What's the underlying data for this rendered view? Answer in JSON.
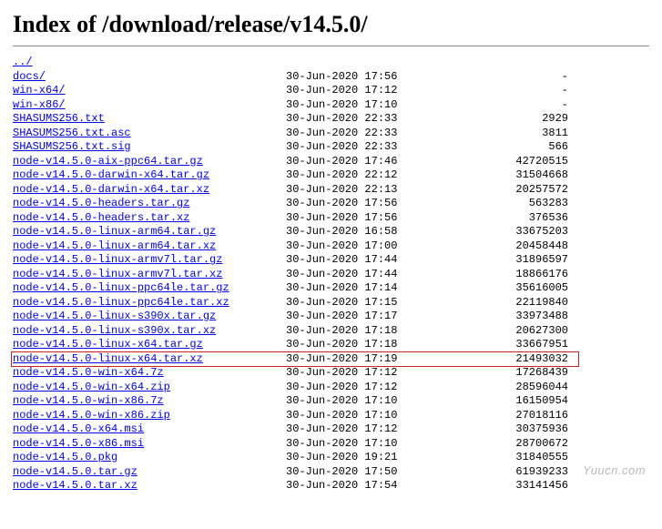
{
  "title": "Index of /download/release/v14.5.0/",
  "watermark": "Yuucn.com",
  "highlight_index": 21,
  "entries": [
    {
      "name": "../",
      "date": "",
      "size": ""
    },
    {
      "name": "docs/",
      "date": "30-Jun-2020 17:56",
      "size": "-"
    },
    {
      "name": "win-x64/",
      "date": "30-Jun-2020 17:12",
      "size": "-"
    },
    {
      "name": "win-x86/",
      "date": "30-Jun-2020 17:10",
      "size": "-"
    },
    {
      "name": "SHASUMS256.txt",
      "date": "30-Jun-2020 22:33",
      "size": "2929"
    },
    {
      "name": "SHASUMS256.txt.asc",
      "date": "30-Jun-2020 22:33",
      "size": "3811"
    },
    {
      "name": "SHASUMS256.txt.sig",
      "date": "30-Jun-2020 22:33",
      "size": "566"
    },
    {
      "name": "node-v14.5.0-aix-ppc64.tar.gz",
      "date": "30-Jun-2020 17:46",
      "size": "42720515"
    },
    {
      "name": "node-v14.5.0-darwin-x64.tar.gz",
      "date": "30-Jun-2020 22:12",
      "size": "31504668"
    },
    {
      "name": "node-v14.5.0-darwin-x64.tar.xz",
      "date": "30-Jun-2020 22:13",
      "size": "20257572"
    },
    {
      "name": "node-v14.5.0-headers.tar.gz",
      "date": "30-Jun-2020 17:56",
      "size": "563283"
    },
    {
      "name": "node-v14.5.0-headers.tar.xz",
      "date": "30-Jun-2020 17:56",
      "size": "376536"
    },
    {
      "name": "node-v14.5.0-linux-arm64.tar.gz",
      "date": "30-Jun-2020 16:58",
      "size": "33675203"
    },
    {
      "name": "node-v14.5.0-linux-arm64.tar.xz",
      "date": "30-Jun-2020 17:00",
      "size": "20458448"
    },
    {
      "name": "node-v14.5.0-linux-armv7l.tar.gz",
      "date": "30-Jun-2020 17:44",
      "size": "31896597"
    },
    {
      "name": "node-v14.5.0-linux-armv7l.tar.xz",
      "date": "30-Jun-2020 17:44",
      "size": "18866176"
    },
    {
      "name": "node-v14.5.0-linux-ppc64le.tar.gz",
      "date": "30-Jun-2020 17:14",
      "size": "35616005"
    },
    {
      "name": "node-v14.5.0-linux-ppc64le.tar.xz",
      "date": "30-Jun-2020 17:15",
      "size": "22119840"
    },
    {
      "name": "node-v14.5.0-linux-s390x.tar.gz",
      "date": "30-Jun-2020 17:17",
      "size": "33973488"
    },
    {
      "name": "node-v14.5.0-linux-s390x.tar.xz",
      "date": "30-Jun-2020 17:18",
      "size": "20627300"
    },
    {
      "name": "node-v14.5.0-linux-x64.tar.gz",
      "date": "30-Jun-2020 17:18",
      "size": "33667951"
    },
    {
      "name": "node-v14.5.0-linux-x64.tar.xz",
      "date": "30-Jun-2020 17:19",
      "size": "21493032"
    },
    {
      "name": "node-v14.5.0-win-x64.7z",
      "date": "30-Jun-2020 17:12",
      "size": "17268439"
    },
    {
      "name": "node-v14.5.0-win-x64.zip",
      "date": "30-Jun-2020 17:12",
      "size": "28596044"
    },
    {
      "name": "node-v14.5.0-win-x86.7z",
      "date": "30-Jun-2020 17:10",
      "size": "16150954"
    },
    {
      "name": "node-v14.5.0-win-x86.zip",
      "date": "30-Jun-2020 17:10",
      "size": "27018116"
    },
    {
      "name": "node-v14.5.0-x64.msi",
      "date": "30-Jun-2020 17:12",
      "size": "30375936"
    },
    {
      "name": "node-v14.5.0-x86.msi",
      "date": "30-Jun-2020 17:10",
      "size": "28700672"
    },
    {
      "name": "node-v14.5.0.pkg",
      "date": "30-Jun-2020 19:21",
      "size": "31840555"
    },
    {
      "name": "node-v14.5.0.tar.gz",
      "date": "30-Jun-2020 17:50",
      "size": "61939233"
    },
    {
      "name": "node-v14.5.0.tar.xz",
      "date": "30-Jun-2020 17:54",
      "size": "33141456"
    }
  ]
}
